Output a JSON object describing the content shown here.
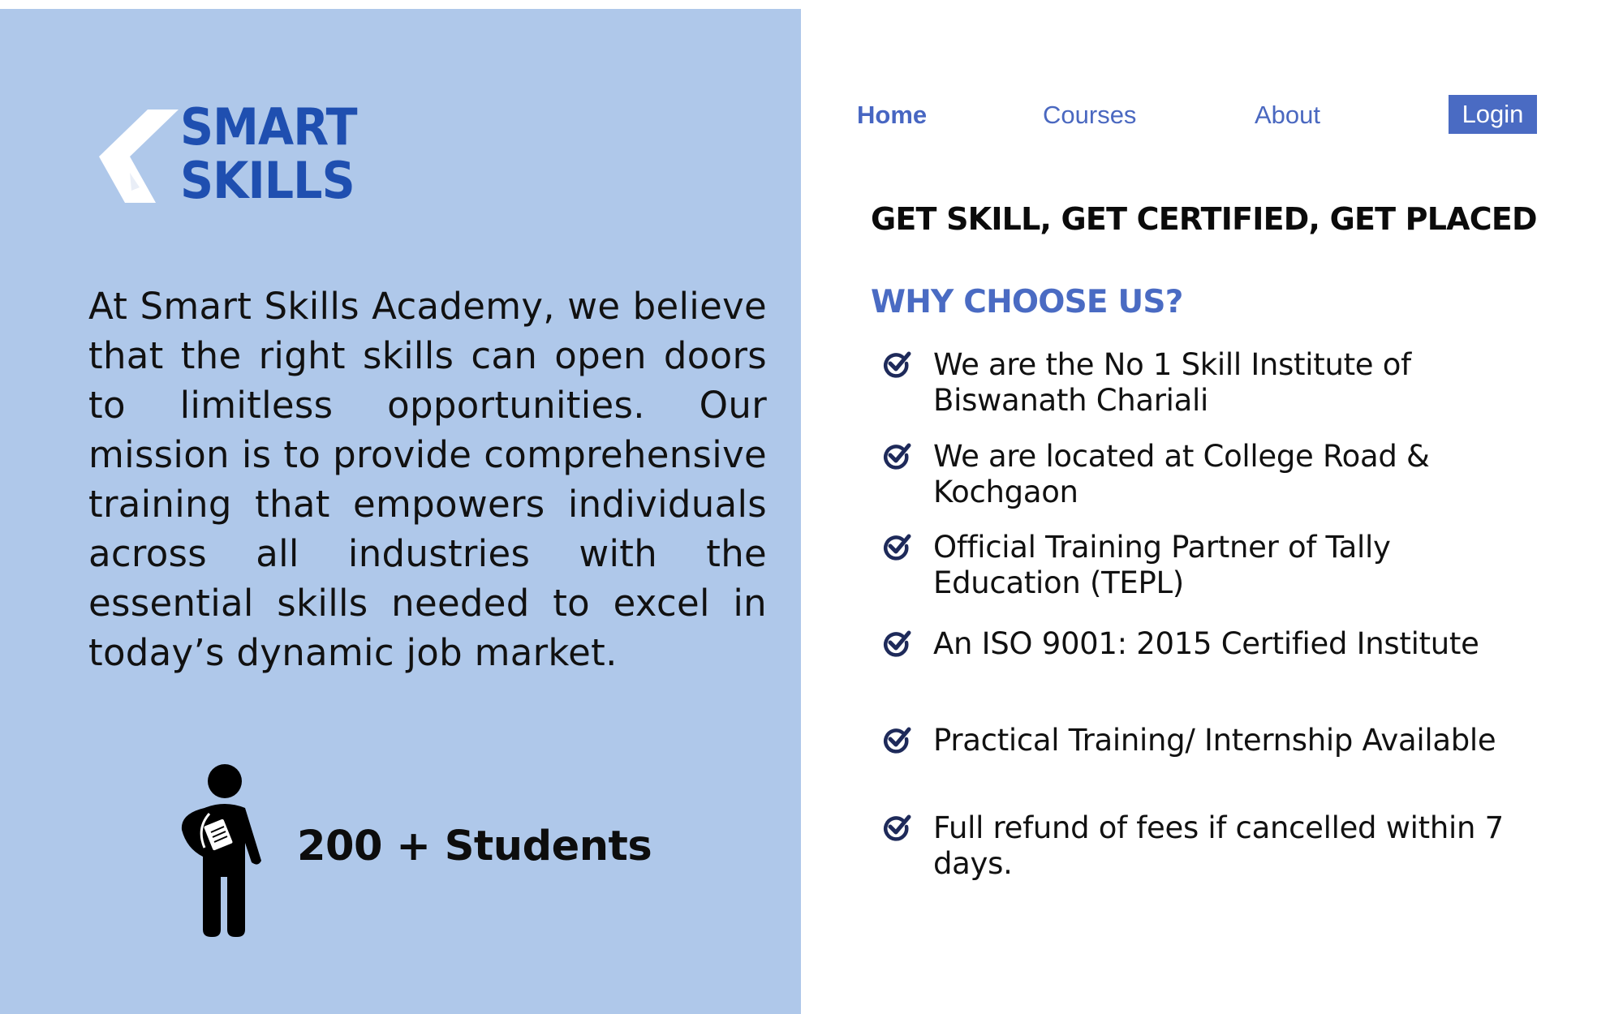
{
  "brand": {
    "logo_line1": "SMART",
    "logo_line2": "SKILLS",
    "logo_color": "#1f4fb0",
    "panel_color": "#afc8ea"
  },
  "mission_text": "At Smart Skills Academy, we believe that the right skills can open doors to limitless opportunities. Our mission is to provide comprehensive training that empowers individuals across all industries with the essential skills needed to excel in today’s dynamic job market.",
  "students": {
    "icon": "student-icon",
    "label": "200 + Students"
  },
  "nav": {
    "items": [
      {
        "label": "Home",
        "active": true
      },
      {
        "label": "Courses",
        "active": false
      },
      {
        "label": "About",
        "active": false
      }
    ],
    "login_label": "Login",
    "accent_color": "#4a6bc3"
  },
  "tagline": "GET SKILL, GET CERTIFIED, GET PLACED",
  "why": {
    "heading": "WHY CHOOSE US?",
    "check_icon": "check-circle-icon",
    "items": [
      "We are the No 1 Skill Institute of Biswanath Chariali",
      "We are located at College Road & Kochgaon",
      "Official Training Partner of Tally Education (TEPL)",
      "An ISO 9001: 2015 Certified Institute",
      "Practical Training/ Internship Available",
      "Full refund of fees if cancelled within 7 days."
    ]
  }
}
